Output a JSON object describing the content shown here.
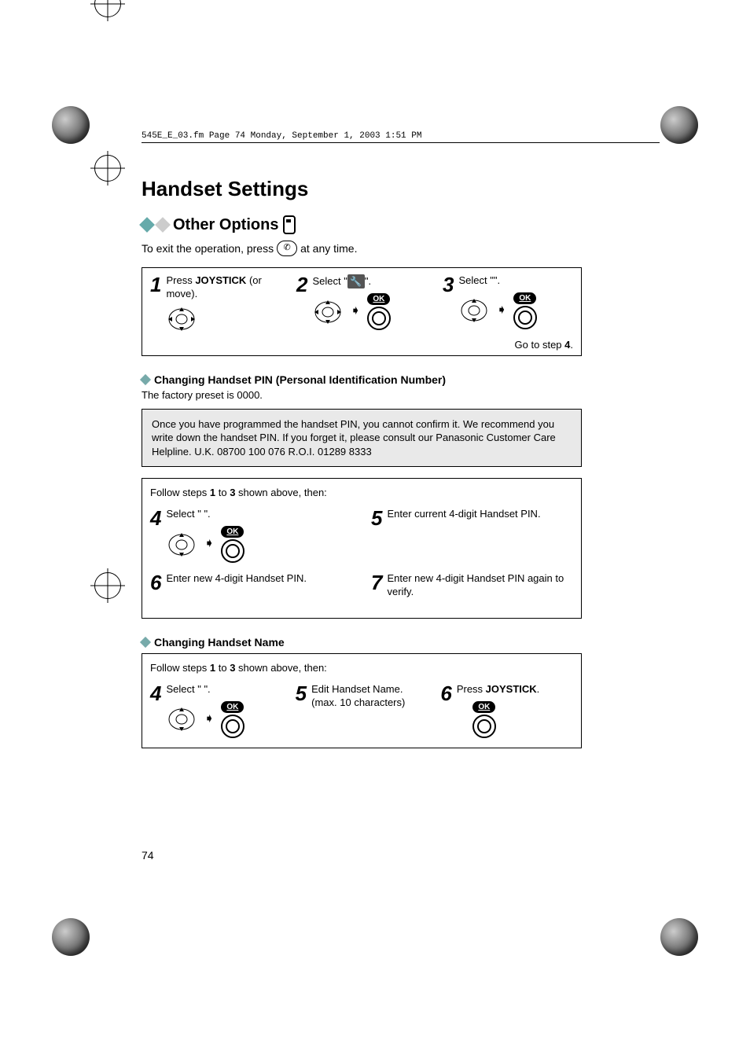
{
  "header_line": "545E_E_03.fm  Page 74  Monday, September 1, 2003  1:51 PM",
  "title": "Handset Settings",
  "section_title": "Other Options",
  "exit_line_pre": "To exit the operation, press ",
  "exit_line_post": " at any time.",
  "steps_top": {
    "s1_label": "1",
    "s1_text_a": "Press ",
    "s1_text_b": "JOYSTICK",
    "s1_text_c": " (or move).",
    "s2_label": "2",
    "s2_text_a": "Select \"",
    "s2_text_b": "\".",
    "s3_label": "3",
    "s3_text_a": "Select \"",
    "s3_text_b": "\".",
    "goto": "Go to step ",
    "goto_num": "4",
    "goto_end": "."
  },
  "ok_label": "OK",
  "subA": {
    "heading": "Changing Handset PIN (Personal Identification Number)",
    "factory": "The factory preset is 0000.",
    "info": "Once you have programmed the handset PIN, you cannot confirm it. We recommend you write down the handset PIN. If you forget it, please consult our Panasonic Customer Care Helpline. U.K. 08700 100 076 R.O.I. 01289 8333",
    "follow_a": "Follow steps ",
    "follow_b": "1",
    "follow_c": " to ",
    "follow_d": "3",
    "follow_e": " shown above, then:",
    "s4_label": "4",
    "s4_text": "Select \"                                  \".",
    "s5_label": "5",
    "s5_text": "Enter current 4-digit Handset PIN.",
    "s6_label": "6",
    "s6_text": "Enter new 4-digit Handset PIN.",
    "s7_label": "7",
    "s7_text": "Enter new 4-digit Handset PIN again to verify."
  },
  "subB": {
    "heading": "Changing Handset Name",
    "follow_a": "Follow steps ",
    "follow_b": "1",
    "follow_c": " to ",
    "follow_d": "3",
    "follow_e": " shown above, then:",
    "s4_label": "4",
    "s4_text": "Select \"                            \".",
    "s5_label": "5",
    "s5_text_a": "Edit Handset Name.",
    "s5_text_b": "(max. 10 characters)",
    "s6_label": "6",
    "s6_text_a": "Press ",
    "s6_text_b": "JOYSTICK",
    "s6_text_c": "."
  },
  "page_number": "74"
}
